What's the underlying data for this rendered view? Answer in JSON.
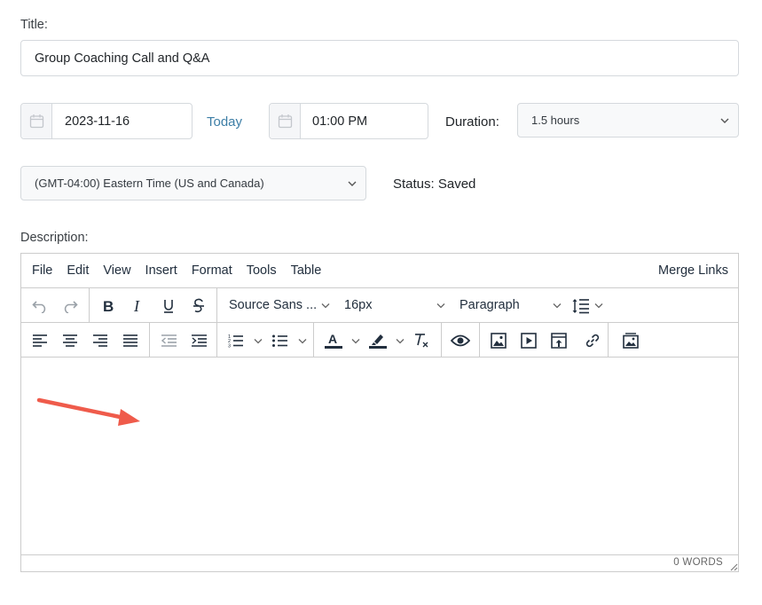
{
  "title_label": "Title:",
  "title_value": "Group Coaching Call and Q&A",
  "date_value": "2023-11-16",
  "today_link": "Today",
  "time_value": "01:00 PM",
  "duration_label": "Duration:",
  "duration_value": "1.5 hours",
  "timezone_value": "(GMT-04:00) Eastern Time (US and Canada)",
  "status_text": "Status: Saved",
  "description_label": "Description:",
  "editor": {
    "menus": [
      "File",
      "Edit",
      "View",
      "Insert",
      "Format",
      "Tools",
      "Table"
    ],
    "merge_links": "Merge Links",
    "font_family": "Source Sans ...",
    "font_size": "16px",
    "block_format": "Paragraph",
    "word_count": "0 WORDS"
  },
  "colors": {
    "link": "#3d7ea6",
    "arrow": "#ef5b4b",
    "border": "#cccccc"
  },
  "icons": [
    "calendar-icon",
    "chevron-down-icon",
    "undo-icon",
    "redo-icon",
    "bold-icon",
    "italic-icon",
    "underline-icon",
    "strikethrough-icon",
    "line-height-icon",
    "align-left-icon",
    "align-center-icon",
    "align-right-icon",
    "justify-icon",
    "outdent-icon",
    "indent-icon",
    "numbered-list-icon",
    "bullet-list-icon",
    "text-color-icon",
    "highlight-icon",
    "clear-formatting-icon",
    "preview-icon",
    "image-icon",
    "media-icon",
    "upload-icon",
    "link-icon",
    "gallery-icon",
    "resize-handle-icon"
  ]
}
